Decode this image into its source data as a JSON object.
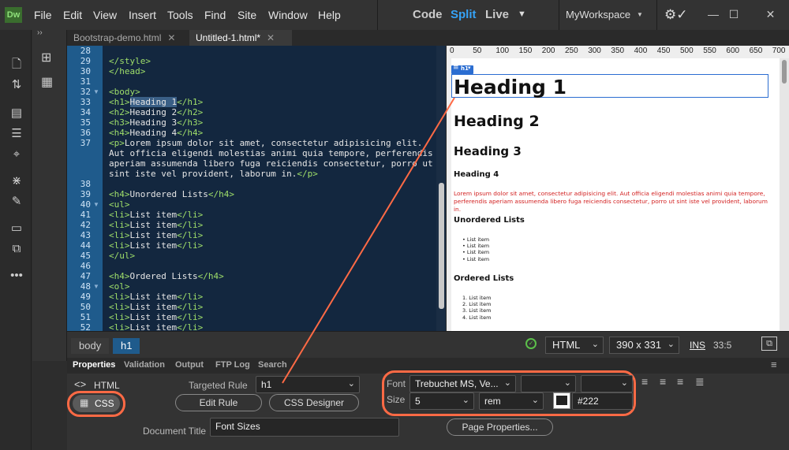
{
  "app": {
    "logo": "Dw"
  },
  "menu": [
    "File",
    "Edit",
    "View",
    "Insert",
    "Tools",
    "Find",
    "Site",
    "Window",
    "Help"
  ],
  "view_modes": {
    "code": "Code",
    "split": "Split",
    "live": "Live"
  },
  "workspace": "MyWorkspace",
  "tabs": [
    {
      "label": "Bootstrap-demo.html"
    },
    {
      "label": "Untitled-1.html*"
    }
  ],
  "code_lines": [
    {
      "n": "28",
      "t": "",
      "fold": false
    },
    {
      "n": "29",
      "t": "</style>",
      "fold": false
    },
    {
      "n": "30",
      "t": "</head>",
      "fold": false
    },
    {
      "n": "31",
      "t": "",
      "fold": false
    },
    {
      "n": "32",
      "t": "<body>",
      "fold": true
    },
    {
      "n": "33",
      "t": "<h1>Heading 1</h1>",
      "fold": false
    },
    {
      "n": "34",
      "t": "<h2>Heading 2</h2>",
      "fold": false
    },
    {
      "n": "35",
      "t": "<h3>Heading 3</h3>",
      "fold": false
    },
    {
      "n": "36",
      "t": "<h4>Heading 4</h4>",
      "fold": false
    },
    {
      "n": "37",
      "t": "<p>Lorem ipsum dolor sit amet, consectetur adipisicing elit.",
      "fold": false
    },
    {
      "n": "",
      "t": "Aut officia eligendi molestias animi quia tempore, perferendis",
      "fold": false
    },
    {
      "n": "",
      "t": "aperiam assumenda libero fuga reiciendis consectetur, porro ut",
      "fold": false
    },
    {
      "n": "",
      "t": "sint iste vel provident, laborum in.</p>",
      "fold": false
    },
    {
      "n": "38",
      "t": "",
      "fold": false
    },
    {
      "n": "39",
      "t": "<h4>Unordered Lists</h4>",
      "fold": false
    },
    {
      "n": "40",
      "t": "<ul>",
      "fold": true
    },
    {
      "n": "41",
      "t": "<li>List item</li>",
      "fold": false
    },
    {
      "n": "42",
      "t": "<li>List item</li>",
      "fold": false
    },
    {
      "n": "43",
      "t": "<li>List item</li>",
      "fold": false
    },
    {
      "n": "44",
      "t": "<li>List item</li>",
      "fold": false
    },
    {
      "n": "45",
      "t": "</ul>",
      "fold": false
    },
    {
      "n": "46",
      "t": "",
      "fold": false
    },
    {
      "n": "47",
      "t": "<h4>Ordered Lists</h4>",
      "fold": false
    },
    {
      "n": "48",
      "t": "<ol>",
      "fold": true
    },
    {
      "n": "49",
      "t": "<li>List item</li>",
      "fold": false
    },
    {
      "n": "50",
      "t": "<li>List item</li>",
      "fold": false
    },
    {
      "n": "51",
      "t": "<li>List item</li>",
      "fold": false
    },
    {
      "n": "52",
      "t": "<li>List item</li>",
      "fold": false
    }
  ],
  "ruler": [
    "0",
    "50",
    "100",
    "150",
    "200",
    "250",
    "300",
    "350",
    "400",
    "450",
    "500",
    "550",
    "600",
    "650",
    "700"
  ],
  "live": {
    "h1_badge": "h1",
    "h1": "Heading 1",
    "h2": "Heading 2",
    "h3": "Heading 3",
    "h4": "Heading 4",
    "paragraph": "Lorem ipsum dolor sit amet, consectetur adipisicing elit. Aut officia eligendi molestias animi quia tempore, perferendis aperiam assumenda libero fuga reiciendis consectetur, porro ut sint iste vel provident, laborum in.",
    "ul_heading": "Unordered Lists",
    "ul_items": [
      "List item",
      "List item",
      "List item",
      "List item"
    ],
    "ol_heading": "Ordered Lists",
    "ol_items": [
      "List item",
      "List item",
      "List item",
      "List item"
    ]
  },
  "tag_selector": {
    "body": "body",
    "h1": "h1"
  },
  "status": {
    "doctype": "HTML",
    "size": "390 x 331",
    "ins": "INS",
    "position": "33:5"
  },
  "panel_tabs": [
    "Properties",
    "Validation",
    "Output",
    "FTP Log",
    "Search"
  ],
  "props": {
    "html_label": "HTML",
    "css_label": "CSS",
    "targeted_rule_label": "Targeted Rule",
    "targeted_rule": "h1",
    "edit_rule": "Edit Rule",
    "css_designer": "CSS Designer",
    "font_label": "Font",
    "font_value": "Trebuchet MS, Ve...",
    "size_label": "Size",
    "size_value": "5",
    "size_unit": "rem",
    "color": "#222",
    "doc_title_label": "Document Title",
    "doc_title": "Font Sizes",
    "page_properties": "Page Properties..."
  },
  "colors": {
    "accent": "#36a3f7",
    "annotation": "#ff6a45",
    "live_paragraph": "#d21f1f"
  }
}
